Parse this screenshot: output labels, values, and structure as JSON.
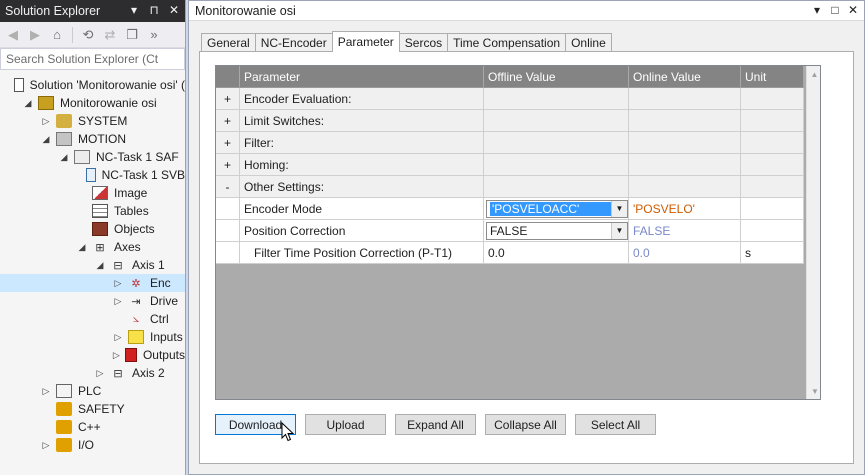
{
  "solution_explorer": {
    "title": "Solution Explorer",
    "title_controls": [
      "▾",
      "⊓",
      "✕"
    ],
    "search_placeholder": "Search Solution Explorer (Ct",
    "tree": [
      {
        "label": "Solution 'Monitorowanie osi' (",
        "icon": "solution-icon",
        "indent": 0,
        "expander": ""
      },
      {
        "label": "Monitorowanie osi",
        "icon": "project-icon",
        "indent": 1,
        "expander": "◢"
      },
      {
        "label": "SYSTEM",
        "icon": "system-icon",
        "indent": 2,
        "expander": "▷"
      },
      {
        "label": "MOTION",
        "icon": "motion-icon",
        "indent": 2,
        "expander": "◢"
      },
      {
        "label": "NC-Task 1 SAF",
        "icon": "task-icon",
        "indent": 3,
        "expander": "◢"
      },
      {
        "label": "NC-Task 1 SVB",
        "icon": "document-icon",
        "indent": 4,
        "expander": ""
      },
      {
        "label": "Image",
        "icon": "image-icon",
        "indent": 4,
        "expander": ""
      },
      {
        "label": "Tables",
        "icon": "tables-icon",
        "indent": 4,
        "expander": ""
      },
      {
        "label": "Objects",
        "icon": "objects-icon",
        "indent": 4,
        "expander": ""
      },
      {
        "label": "Axes",
        "icon": "axes-icon",
        "indent": 4,
        "expander": "◢"
      },
      {
        "label": "Axis 1",
        "icon": "axis-icon",
        "indent": 5,
        "expander": "◢"
      },
      {
        "label": "Enc",
        "icon": "encoder-icon",
        "indent": 6,
        "expander": "▷",
        "selected": true
      },
      {
        "label": "Drive",
        "icon": "drive-icon",
        "indent": 6,
        "expander": "▷"
      },
      {
        "label": "Ctrl",
        "icon": "controller-icon",
        "indent": 6,
        "expander": ""
      },
      {
        "label": "Inputs",
        "icon": "inputs-icon",
        "indent": 6,
        "expander": "▷"
      },
      {
        "label": "Outputs",
        "icon": "outputs-icon",
        "indent": 6,
        "expander": "▷"
      },
      {
        "label": "Axis 2",
        "icon": "axis-icon",
        "indent": 5,
        "expander": "▷"
      },
      {
        "label": "PLC",
        "icon": "plc-icon",
        "indent": 2,
        "expander": "▷"
      },
      {
        "label": "SAFETY",
        "icon": "safety-icon",
        "indent": 2,
        "expander": ""
      },
      {
        "label": "C++",
        "icon": "cpp-icon",
        "indent": 2,
        "expander": ""
      },
      {
        "label": "I/O",
        "icon": "io-icon",
        "indent": 2,
        "expander": "▷"
      }
    ]
  },
  "main_window": {
    "title": "Monitorowanie osi",
    "title_controls": [
      "▾",
      "□",
      "✕"
    ],
    "tabs": [
      "General",
      "NC-Encoder",
      "Parameter",
      "Sercos",
      "Time Compensation",
      "Online"
    ],
    "active_tab": "Parameter",
    "grid": {
      "headers": [
        "",
        "Parameter",
        "Offline Value",
        "Online Value",
        "Unit"
      ],
      "rows": [
        {
          "type": "group",
          "marker": "+",
          "name": "Encoder Evaluation:",
          "offline": "",
          "online": "",
          "unit": ""
        },
        {
          "type": "group",
          "marker": "+",
          "name": "Limit Switches:",
          "offline": "",
          "online": "",
          "unit": ""
        },
        {
          "type": "group",
          "marker": "+",
          "name": "Filter:",
          "offline": "",
          "online": "",
          "unit": ""
        },
        {
          "type": "group",
          "marker": "+",
          "name": "Homing:",
          "offline": "",
          "online": "",
          "unit": ""
        },
        {
          "type": "group",
          "marker": "-",
          "name": "Other Settings:",
          "offline": "",
          "online": "",
          "unit": ""
        },
        {
          "type": "setting",
          "marker": "",
          "name": "Encoder Mode",
          "offline": "'POSVELOACC'",
          "online": "'POSVELO'",
          "unit": "",
          "dropdown": true,
          "highlighted": true,
          "online_color": "#d05a00"
        },
        {
          "type": "setting",
          "marker": "",
          "name": "Position Correction",
          "offline": "FALSE",
          "online": "FALSE",
          "unit": "",
          "dropdown": true,
          "highlighted": false,
          "online_color": "#7a88c9"
        },
        {
          "type": "setting",
          "marker": "",
          "name": "   Filter Time Position Correction (P-T1)",
          "offline": "0.0",
          "online": "0.0",
          "unit": "s",
          "dropdown": false,
          "online_color": "#7a88c9"
        }
      ]
    },
    "buttons": [
      "Download",
      "Upload",
      "Expand All",
      "Collapse All",
      "Select All"
    ]
  },
  "colors": {
    "grid_header_bg": "#848484",
    "grid_empty_bg": "#ababab",
    "selection": "#3399ff",
    "online_changed": "#d05a00",
    "online_same": "#7a88c9",
    "tree_selected": "#cce8ff"
  }
}
